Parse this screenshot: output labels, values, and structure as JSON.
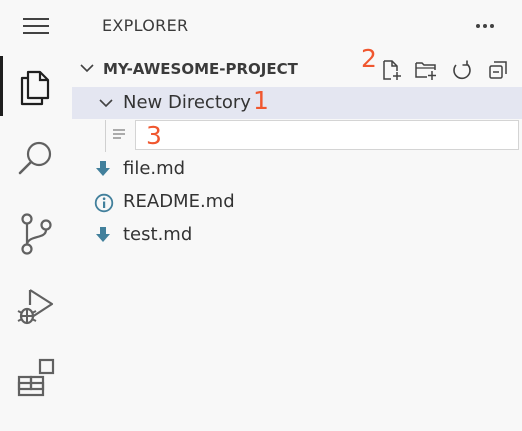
{
  "activity_bar": {
    "items": [
      {
        "icon": "files-icon",
        "active": true
      },
      {
        "icon": "search-icon",
        "active": false
      },
      {
        "icon": "source-control-icon",
        "active": false
      },
      {
        "icon": "run-debug-icon",
        "active": false
      },
      {
        "icon": "extensions-icon",
        "active": false
      }
    ]
  },
  "sidebar": {
    "title": "EXPLORER",
    "more_icon": "ellipsis-icon",
    "section": {
      "title": "MY-AWESOME-PROJECT",
      "tools": [
        "new-file-icon",
        "new-folder-icon",
        "refresh-icon",
        "collapse-all-icon"
      ]
    },
    "tree": {
      "folder": {
        "label": "New Directory",
        "expanded": true
      },
      "new_file_input": {
        "value": "",
        "icon": "file-text-icon"
      },
      "files": [
        {
          "label": "file.md",
          "icon": "markdown-arrow-icon"
        },
        {
          "label": "README.md",
          "icon": "info-icon"
        },
        {
          "label": "test.md",
          "icon": "markdown-arrow-icon"
        }
      ]
    }
  },
  "annotations": {
    "one": "1",
    "two": "2",
    "three": "3"
  },
  "colors": {
    "accent_orange": "#f0572f",
    "markdown_blue": "#42809c",
    "selection_bg": "#e4e6f1"
  }
}
